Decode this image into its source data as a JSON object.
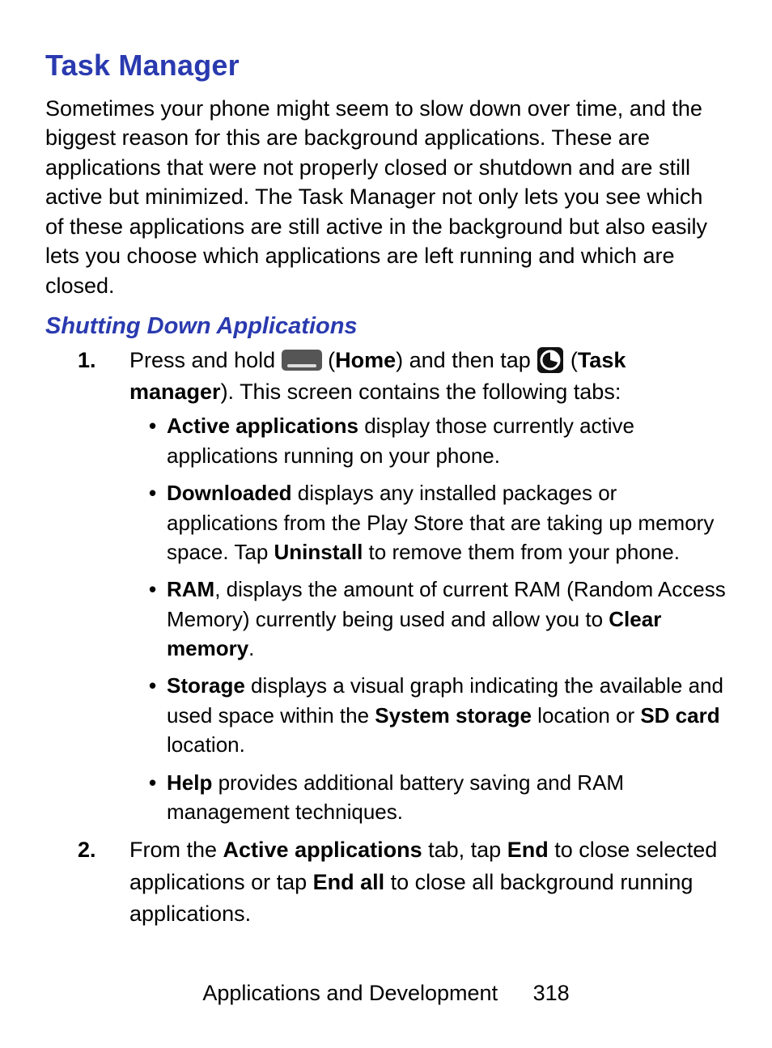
{
  "title": "Task Manager",
  "intro": "Sometimes your phone might seem to slow down over time, and the biggest reason for this are background applications. These are applications that were not properly closed or shutdown and are still active but minimized. The Task Manager not only lets you see which of these applications are still active in the background but also easily lets you choose which applications are left running and which are closed.",
  "subsection": "Shutting Down Applications",
  "steps": {
    "num1": "1.",
    "num2": "2.",
    "s1": {
      "press_and_hold": "Press and hold ",
      "home_label": "Home",
      "and_then_tap": ") and then tap ",
      "task_manager_label": "Task manager",
      "this_screen": "). This screen contains the following tabs:"
    },
    "bullets": {
      "active_b": "Active applications",
      "active_t": " display those currently active applications running on your phone.",
      "downloaded_b": "Downloaded",
      "downloaded_t1": " displays any installed packages or applications from the Play Store that are taking up memory space. Tap ",
      "uninstall_b": "Uninstall",
      "downloaded_t2": " to remove them from your phone.",
      "ram_b": "RAM",
      "ram_t1": ", displays the amount of current RAM (Random Access Memory) currently being used and allow you to ",
      "clear_memory_b": "Clear memory",
      "ram_t2": ".",
      "storage_b": "Storage",
      "storage_t1": " displays a visual graph indicating the available and used space within the ",
      "system_storage_b": "System storage",
      "storage_t2": " location or ",
      "sdcard_b": "SD card",
      "storage_t3": " location.",
      "help_b": "Help",
      "help_t": " provides additional battery saving and RAM management techniques."
    },
    "s2": {
      "t1": "From the ",
      "active_apps_b": "Active applications",
      "t2": " tab, tap ",
      "end_b": "End",
      "t3": " to close selected applications or tap ",
      "end_all_b": "End all",
      "t4": " to close all background running applications."
    }
  },
  "footer": {
    "section": "Applications and Development",
    "page": "318"
  }
}
